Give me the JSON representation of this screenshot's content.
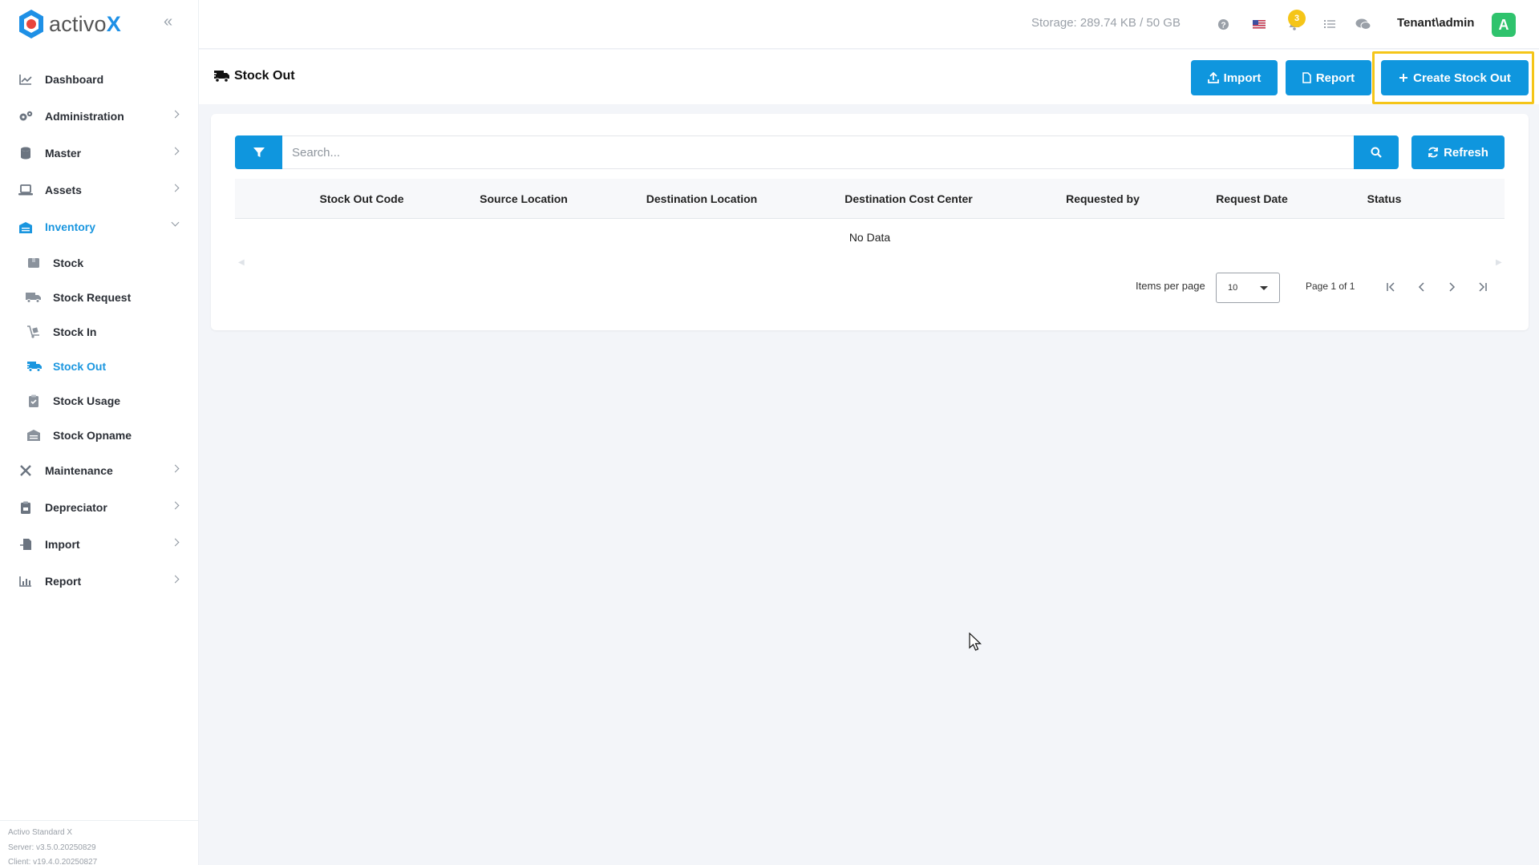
{
  "app": {
    "logo_text": "activo",
    "logo_x": "X"
  },
  "sidebar": {
    "items": [
      {
        "label": "Dashboard",
        "icon": "chart-line-icon"
      },
      {
        "label": "Administration",
        "icon": "gears-icon"
      },
      {
        "label": "Master",
        "icon": "database-icon"
      },
      {
        "label": "Assets",
        "icon": "laptop-icon"
      },
      {
        "label": "Inventory",
        "icon": "warehouse-icon"
      },
      {
        "label": "Maintenance",
        "icon": "tools-icon"
      },
      {
        "label": "Depreciator",
        "icon": "clipboard-icon"
      },
      {
        "label": "Import",
        "icon": "file-import-icon"
      },
      {
        "label": "Report",
        "icon": "bar-chart-icon"
      }
    ],
    "inventory_sub": [
      {
        "label": "Stock",
        "icon": "box-icon"
      },
      {
        "label": "Stock Request",
        "icon": "truck-icon"
      },
      {
        "label": "Stock In",
        "icon": "dolly-icon"
      },
      {
        "label": "Stock Out",
        "icon": "truck-fast-icon"
      },
      {
        "label": "Stock Usage",
        "icon": "clipboard-check-icon"
      },
      {
        "label": "Stock Opname",
        "icon": "warehouse-icon"
      }
    ],
    "footer": {
      "product": "Activo Standard X",
      "server": "Server: v3.5.0.20250829",
      "client": "Client: v19.4.0.20250827"
    }
  },
  "topbar": {
    "storage": "Storage: 289.74 KB / 50 GB",
    "notification_count": "3",
    "user": "Tenant\\admin",
    "avatar_letter": "A"
  },
  "page": {
    "title": "Stock Out",
    "buttons": {
      "import": "Import",
      "report": "Report",
      "create": "Create Stock Out"
    }
  },
  "table": {
    "search_placeholder": "Search...",
    "refresh_label": "Refresh",
    "columns": [
      "Stock Out Code",
      "Source Location",
      "Destination Location",
      "Destination Cost Center",
      "Requested by",
      "Request Date",
      "Status"
    ],
    "empty_text": "No Data",
    "items_per_page_label": "Items per page",
    "items_per_page": "10",
    "page_info": "Page 1 of 1"
  },
  "colors": {
    "accent": "#0f96de",
    "highlight": "#f5c518",
    "avatar": "#2fc36d"
  }
}
